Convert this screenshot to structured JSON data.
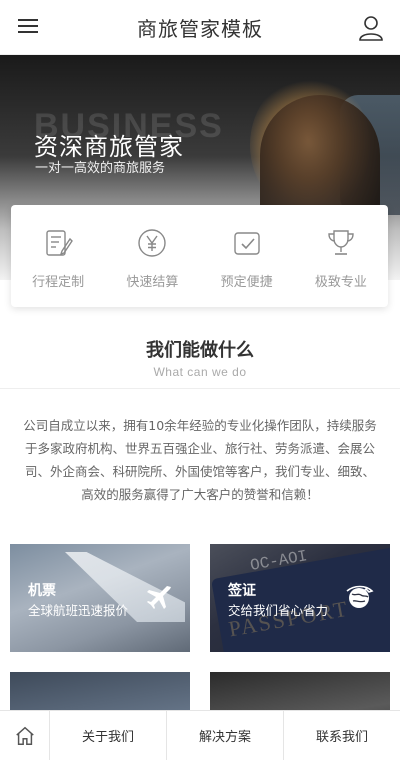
{
  "header": {
    "title": "商旅管家模板",
    "menu_icon": "menu-icon",
    "user_icon": "user-icon"
  },
  "hero": {
    "background_word": "BUSINESS",
    "heading": "资深商旅管家",
    "subheading": "一对一高效的商旅服务"
  },
  "features": [
    {
      "label": "行程定制",
      "icon": "itinerary-edit-icon"
    },
    {
      "label": "快速结算",
      "icon": "yen-coin-icon"
    },
    {
      "label": "预定便捷",
      "icon": "booking-check-icon"
    },
    {
      "label": "极致专业",
      "icon": "trophy-icon"
    }
  ],
  "section": {
    "title": "我们能做什么",
    "subtitle": "What can we do",
    "intro": "公司自成立以来，拥有10余年经验的专业化操作团队，持续服务于多家政府机构、世界五百强企业、旅行社、劳务派遣、会展公司、外企商会、科研院所、外国使馆等客户，我们专业、细致、高效的服务赢得了广大客户的赞誉和信赖！"
  },
  "services": [
    {
      "title": "机票",
      "desc": "全球航班迅速报价",
      "icon": "airplane-icon"
    },
    {
      "title": "签证",
      "desc": "交给我们省心省力",
      "icon": "globe-plane-icon",
      "stamp": "OC-AOI",
      "passport_word": "PASSPORT"
    },
    {
      "title": "",
      "desc": ""
    },
    {
      "title": "",
      "desc": ""
    }
  ],
  "bottom_nav": {
    "home_icon": "home-icon",
    "items": [
      {
        "label": "关于我们"
      },
      {
        "label": "解决方案"
      },
      {
        "label": "联系我们"
      }
    ]
  },
  "colors": {
    "accent_text": "#333333",
    "muted_text": "#999999"
  }
}
